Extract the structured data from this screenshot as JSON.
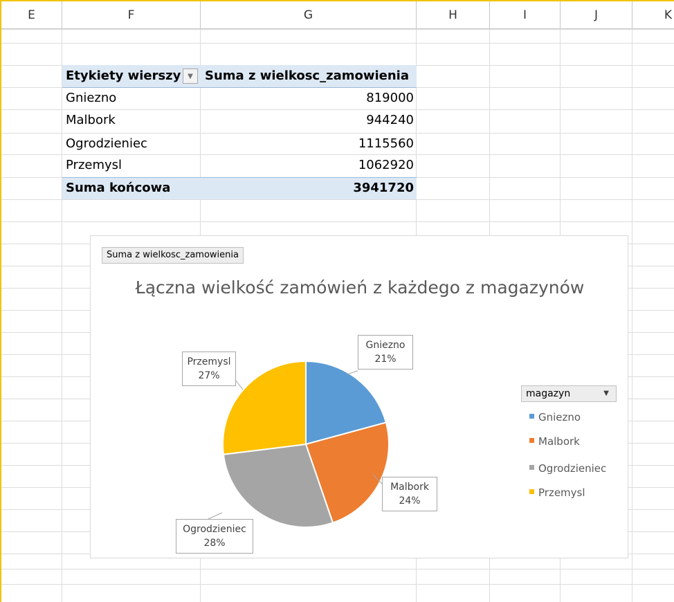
{
  "columns": [
    "E",
    "F",
    "G",
    "H",
    "I",
    "J",
    "K"
  ],
  "pivot": {
    "header_row_label": "Etykiety wierszy",
    "header_value_label": "Suma z wielkosc_zamowienia",
    "rows": [
      {
        "label": "Gniezno",
        "value": "819000"
      },
      {
        "label": "Malbork",
        "value": "944240"
      },
      {
        "label": "Ogrodzieniec",
        "value": "1115560"
      },
      {
        "label": "Przemysl",
        "value": "1062920"
      }
    ],
    "total_label": "Suma końcowa",
    "total_value": "3941720"
  },
  "chart": {
    "field_button": "Suma z wielkosc_zamowienia",
    "legend_button": "magazyn",
    "colors": {
      "Gniezno": "#5b9bd5",
      "Malbork": "#ed7d31",
      "Ogrodzieniec": "#a5a5a5",
      "Przemysl": "#ffc000"
    }
  },
  "chart_data": {
    "type": "pie",
    "title": "Łączna wielkość zamówień z każdego z magazynów",
    "categories": [
      "Gniezno",
      "Malbork",
      "Ogrodzieniec",
      "Przemysl"
    ],
    "values": [
      819000,
      944240,
      1115560,
      1062920
    ],
    "data_labels": [
      "21%",
      "24%",
      "28%",
      "27%"
    ],
    "legend": {
      "title": "magazyn",
      "position": "right"
    }
  }
}
